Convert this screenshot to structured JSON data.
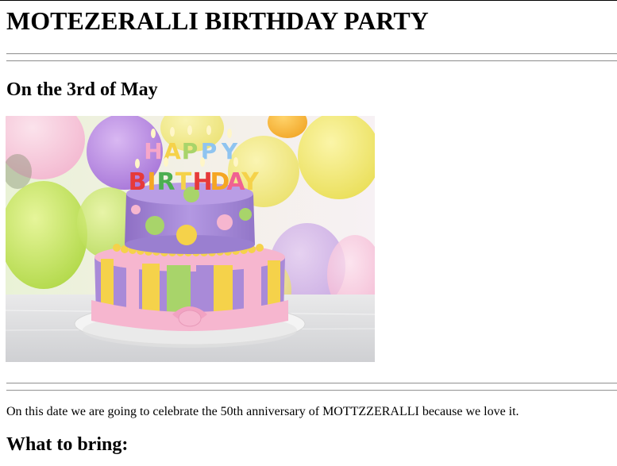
{
  "page": {
    "title": "MOTEZERALLI BIRTHDAY PARTY",
    "date_heading": "On the 3rd of May",
    "intro_text": "On this date we are going to celebrate the 50th anniversary of MOTTZZERALLI because we love it.",
    "bring_heading": "What to bring:"
  },
  "image": {
    "subject": "birthday-cake-photo",
    "candles_top": "HAPPY",
    "candles_bottom": "BIRTHDAY"
  },
  "colors": {
    "text": "#000000",
    "hr": "#9a9a9a",
    "cake_purple": "#a98ad8",
    "cake_yellow": "#f5d24a",
    "cake_green": "#a8d46a",
    "cake_pink": "#f6b6cf"
  }
}
